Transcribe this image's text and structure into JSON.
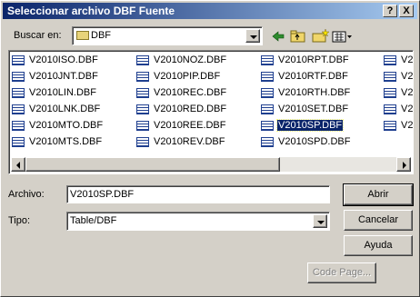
{
  "window": {
    "title": "Seleccionar archivo DBF Fuente",
    "help_label": "?",
    "close_label": "X"
  },
  "lookin": {
    "label": "Buscar en:",
    "value": "DBF"
  },
  "toolbar": {
    "back_icon": "back-arrow-icon",
    "up_icon": "up-folder-icon",
    "newfolder_icon": "new-folder-icon",
    "view_icon": "view-menu-icon"
  },
  "files": [
    [
      "V2010ISO.DBF",
      "V2010JNT.DBF",
      "V2010LIN.DBF",
      "V2010LNK.DBF",
      "V2010MTO.DBF",
      "V2010MTS.DBF"
    ],
    [
      "V2010NOZ.DBF",
      "V2010PIP.DBF",
      "V2010REC.DBF",
      "V2010RED.DBF",
      "V2010REE.DBF",
      "V2010REV.DBF"
    ],
    [
      "V2010RPT.DBF",
      "V2010RTF.DBF",
      "V2010RTH.DBF",
      "V2010SET.DBF",
      "V2010SP.DBF",
      "V2010SPD.DBF"
    ],
    [
      "V2",
      "V2",
      "V2",
      "V2",
      "V2",
      ""
    ]
  ],
  "selected_file": "V2010SP.DBF",
  "filename": {
    "label": "Archivo:",
    "value": "V2010SP.DBF"
  },
  "filetype": {
    "label": "Tipo:",
    "value": "Table/DBF"
  },
  "buttons": {
    "open": "Abrir",
    "cancel": "Cancelar",
    "help": "Ayuda",
    "codepage": "Code Page..."
  }
}
